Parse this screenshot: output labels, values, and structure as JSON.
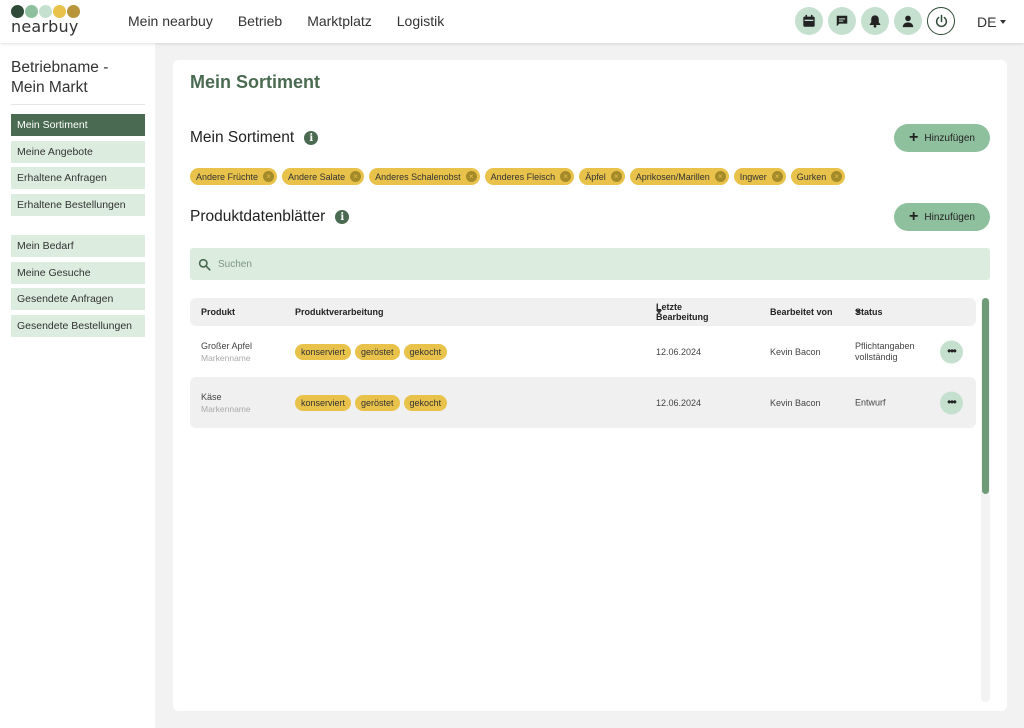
{
  "brand": {
    "logo_text": "nearbuy",
    "dot_colors": [
      "#2f4a36",
      "#8fc09e",
      "#c5e0cf",
      "#e8c24a",
      "#b8953a"
    ]
  },
  "topnav": {
    "links": [
      "Mein nearbuy",
      "Betrieb",
      "Marktplatz",
      "Logistik"
    ],
    "icons": [
      "calendar-icon",
      "chat-icon",
      "bell-icon",
      "user-icon"
    ],
    "language": "DE"
  },
  "sidebar": {
    "title": "Betriebname - Mein Markt",
    "group1": [
      "Mein Sortiment",
      "Meine Angebote",
      "Erhaltene Anfragen",
      "Erhaltene Bestellungen"
    ],
    "group2": [
      "Mein Bedarf",
      "Meine Gesuche",
      "Gesendete Anfragen",
      "Gesendete Bestellungen"
    ],
    "active": "Mein Sortiment"
  },
  "main": {
    "page_title": "Mein Sortiment",
    "sortiment_title": "Mein Sortiment",
    "add_label": "Hinzufügen",
    "sortiment_chips": [
      "Andere Früchte",
      "Andere Salate",
      "Anderes Schalenobst",
      "Anderes Fleisch",
      "Äpfel",
      "Aprikosen/Marillen",
      "Ingwer",
      "Gurken"
    ],
    "datasheets_title": "Produktdatenblätter",
    "search_placeholder": "Suchen"
  },
  "table": {
    "headers": {
      "product": "Produkt",
      "processing": "Produktverarbeitung",
      "last_edit": "Letzte Bearbeitung",
      "edited_by": "Bearbeitet von",
      "status": "Status"
    },
    "rows": [
      {
        "product": "Großer Apfel",
        "brand": "Markenname",
        "processing": [
          "konserviert",
          "geröstet",
          "gekocht"
        ],
        "last_edit": "12.06.2024",
        "edited_by": "Kevin Bacon",
        "status": "Pflichtangaben vollständig"
      },
      {
        "product": "Käse",
        "brand": "Markenname",
        "processing": [
          "konserviert",
          "geröstet",
          "gekocht"
        ],
        "last_edit": "12.06.2024",
        "edited_by": "Kevin Bacon",
        "status": "Entwurf"
      }
    ]
  },
  "colors": {
    "accent_dark": "#4a6b51",
    "accent_light": "#c5e0cf",
    "chip_yellow": "#e8c24a"
  }
}
